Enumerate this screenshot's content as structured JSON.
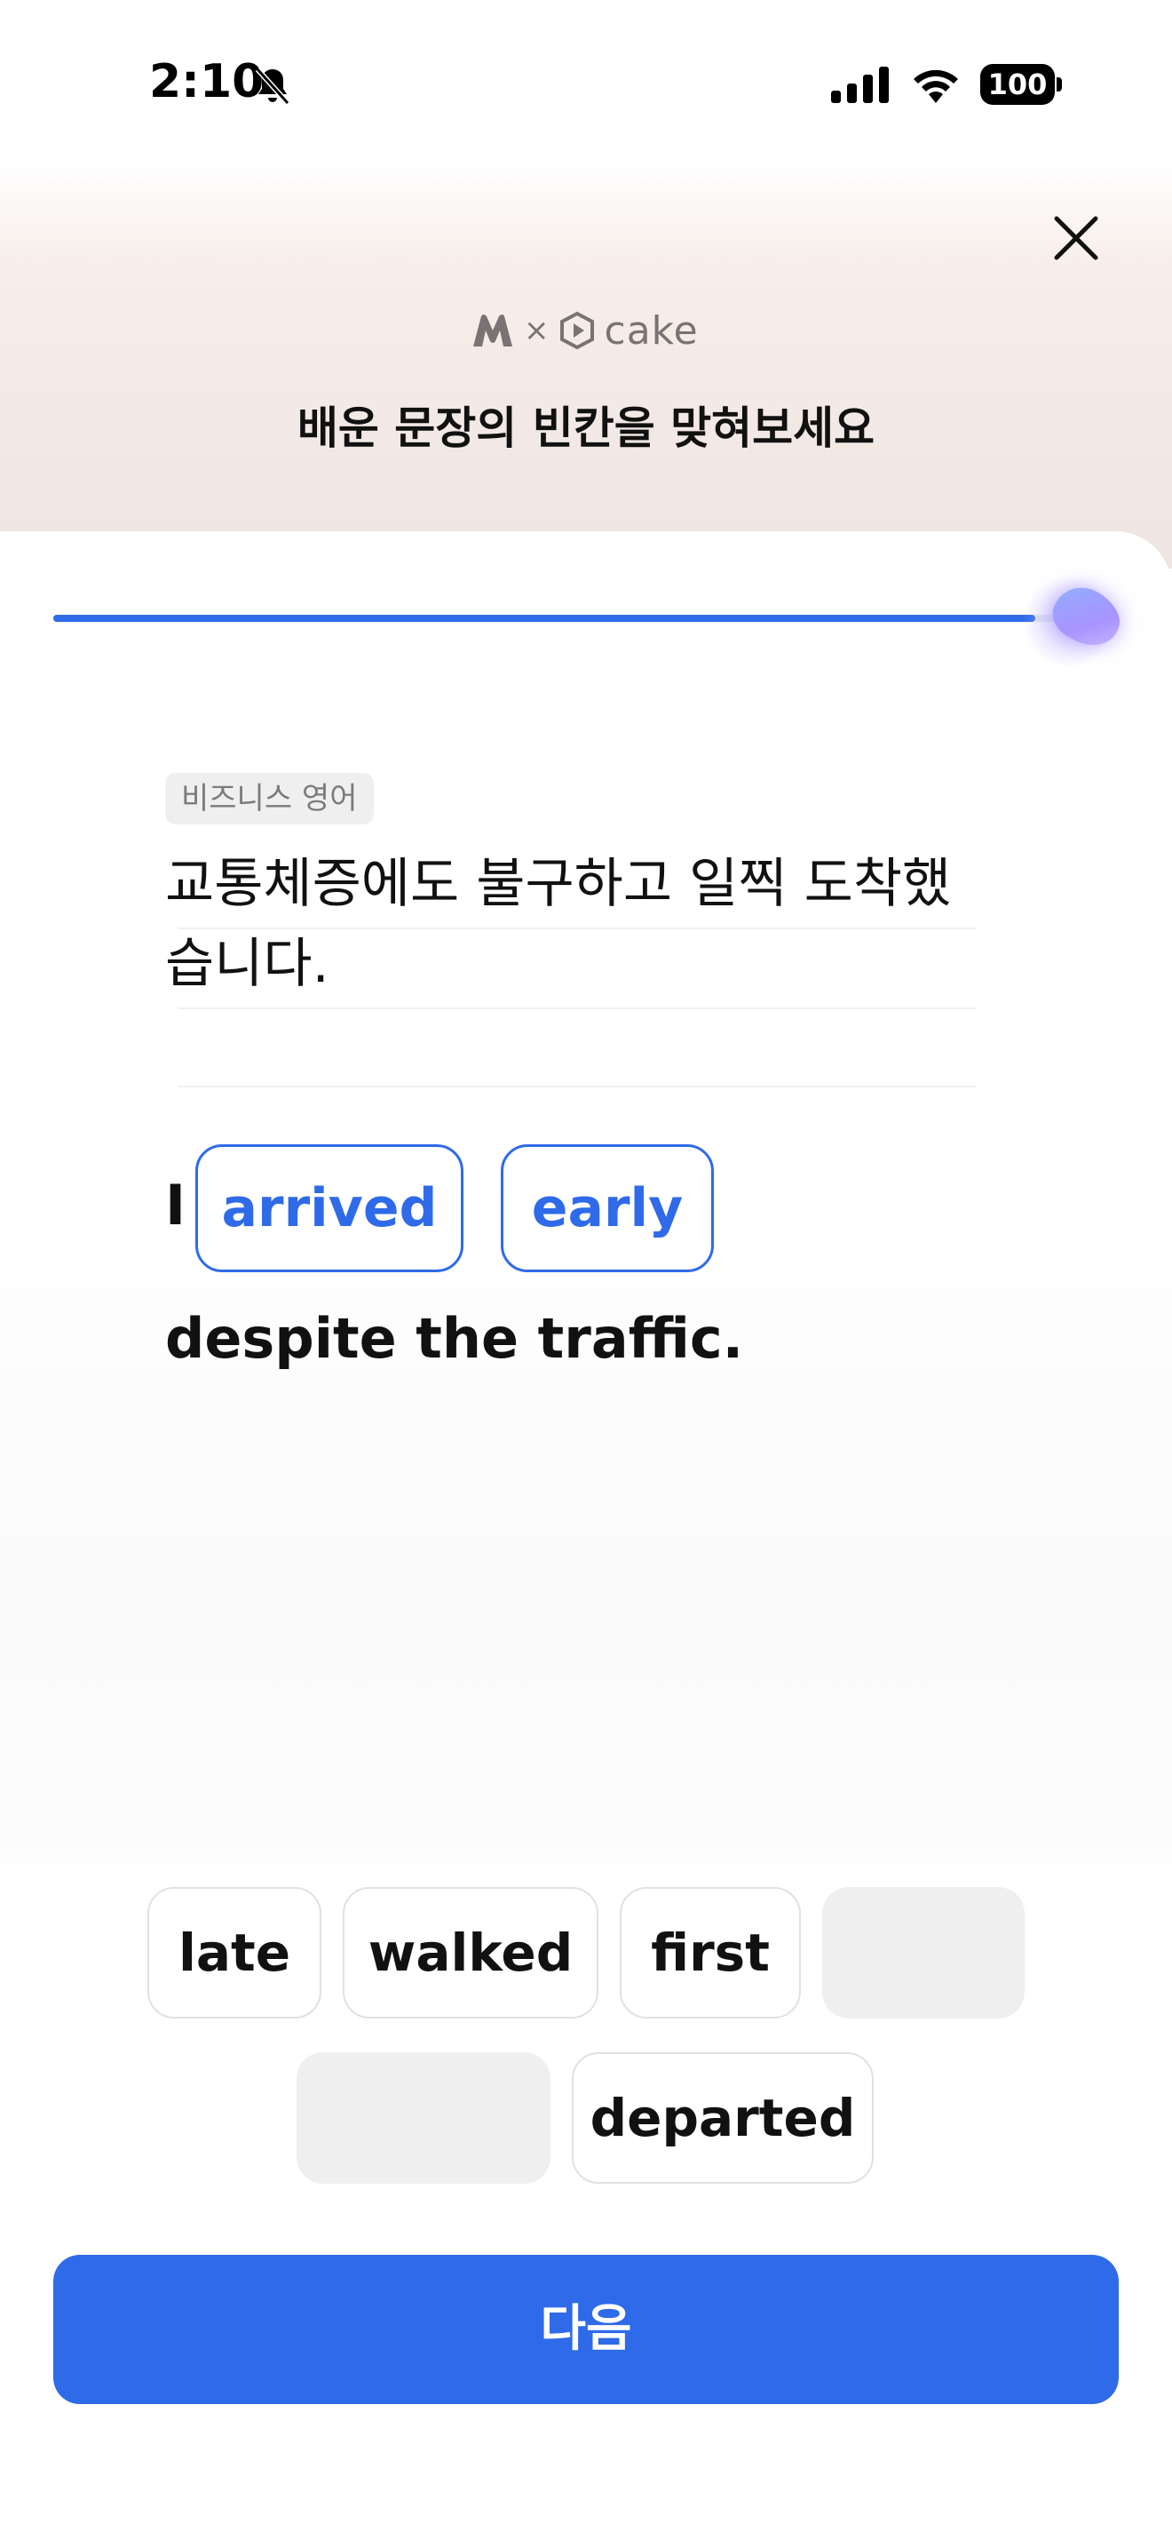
{
  "status_bar": {
    "time": "2:10",
    "battery": "100",
    "icons": [
      "bell-muted-icon",
      "signal-icon",
      "wifi-icon",
      "battery-icon"
    ]
  },
  "header": {
    "close_icon": "close-icon",
    "logo": {
      "separator": "×",
      "brand": "cake"
    },
    "subtitle": "배운 문장의 빈칸을 맞혀보세요"
  },
  "progress": {
    "value": 0.97
  },
  "question": {
    "category": "비즈니스 영어",
    "korean": "교통체증에도 불구하고 일찍 도착했습니다.",
    "sentence_start": "I",
    "filled_words": [
      "arrived",
      "early"
    ],
    "sentence_end": "despite the traffic."
  },
  "options": [
    "late",
    "walked",
    "first",
    "",
    "",
    "departed"
  ],
  "footer": {
    "next_label": "다음"
  },
  "colors": {
    "accent": "#2f6ae8",
    "chip_border": "#e1e1e1",
    "empty_chip": "#efefef"
  }
}
